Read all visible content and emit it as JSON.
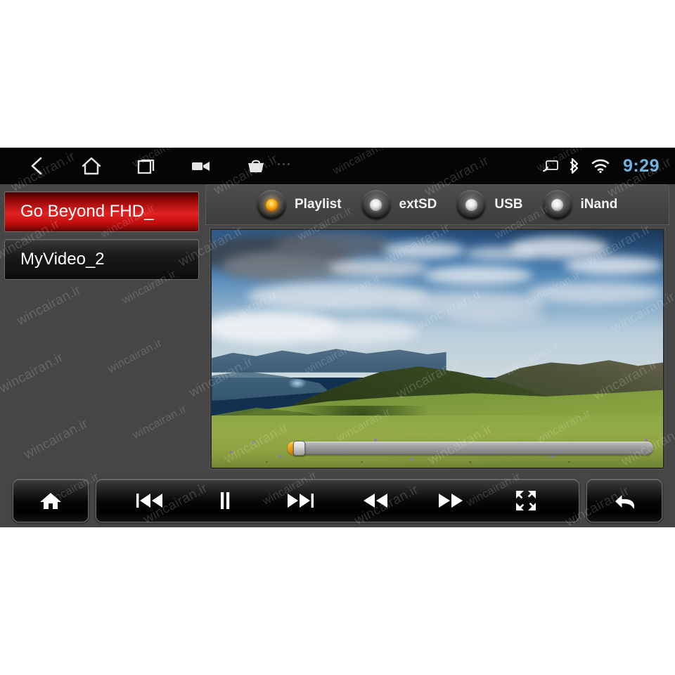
{
  "meta": {
    "app_title": "Video Player",
    "watermark_text": "wincairan.ir"
  },
  "statusbar": {
    "nav": [
      {
        "name": "back-icon",
        "label": "Back"
      },
      {
        "name": "home-icon",
        "label": "Home"
      },
      {
        "name": "recents-icon",
        "label": "Recent apps"
      },
      {
        "name": "camera-icon",
        "label": "Camera"
      },
      {
        "name": "basket-icon",
        "label": "Apps"
      }
    ],
    "overflow_label": "More options",
    "icons": [
      {
        "name": "cast-icon",
        "label": "Screen cast"
      },
      {
        "name": "bluetooth-icon",
        "label": "Bluetooth"
      },
      {
        "name": "wifi-icon",
        "label": "Wi-Fi"
      }
    ],
    "clock": "9:29",
    "clock_color": "#6fb4e0"
  },
  "playlist": {
    "items": [
      {
        "label": "Go Beyond FHD_",
        "selected": true
      },
      {
        "label": "MyVideo_2",
        "selected": false
      }
    ],
    "selected_color": "#e22222"
  },
  "sources": {
    "options": [
      {
        "label": "Playlist",
        "active": true
      },
      {
        "label": "extSD",
        "active": false
      },
      {
        "label": "USB",
        "active": false
      },
      {
        "label": "iNand",
        "active": false
      }
    ],
    "active_led_color": "#ffbb18",
    "idle_led_color": "#e8e8e8"
  },
  "player": {
    "state": "playing",
    "progress_percent": 2,
    "seek_fill_color": "#f0a31a",
    "seek_track_color": "#a9a9a9"
  },
  "transport": {
    "home": {
      "label": "Home",
      "icon": "home-icon"
    },
    "controls": [
      {
        "label": "Previous",
        "icon": "previous-track-icon"
      },
      {
        "label": "Pause",
        "icon": "pause-icon"
      },
      {
        "label": "Next",
        "icon": "next-track-icon"
      },
      {
        "label": "Rewind",
        "icon": "rewind-icon"
      },
      {
        "label": "Fast forward",
        "icon": "fast-forward-icon"
      },
      {
        "label": "Fullscreen",
        "icon": "fullscreen-icon"
      }
    ],
    "back": {
      "label": "Return",
      "icon": "return-arrow-icon"
    }
  }
}
